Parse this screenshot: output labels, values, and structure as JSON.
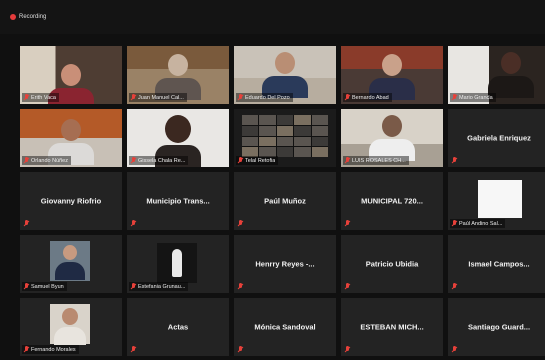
{
  "recording": {
    "label": "Recording"
  },
  "colors": {
    "muted_icon": "#e8413a",
    "tile_bg": "#232323",
    "background": "#101010"
  },
  "tiles": [
    {
      "label": "Erith Vaca"
    },
    {
      "label": "Juan Manuel Cal..."
    },
    {
      "label": "Eduardo Del Pozo"
    },
    {
      "label": "Bernardo Abad"
    },
    {
      "label": "Mario Granda"
    },
    {
      "label": "Orlando Núñez"
    },
    {
      "label": "Gissela Chala Re..."
    },
    {
      "label": "Telal Retofia"
    },
    {
      "label": "LUIS ROSALES CH..."
    },
    {
      "name": "Gabriela Enriquez"
    },
    {
      "name": "Giovanny Riofrio"
    },
    {
      "name": "Municipio Trans..."
    },
    {
      "name": "Paúl Muñoz"
    },
    {
      "name": "MUNICIPAL 720..."
    },
    {
      "label": "Paúl Andino Sal..."
    },
    {
      "label": "Samuel Byun"
    },
    {
      "label": "Estefania Grunau..."
    },
    {
      "name": "Henrry Reyes -..."
    },
    {
      "name": "Patricio Ubidia"
    },
    {
      "name": "Ismael Campos..."
    },
    {
      "label": "Fernando Morales"
    },
    {
      "name": "Actas"
    },
    {
      "name": "Mónica Sandoval"
    },
    {
      "name": "ESTEBAN MICH..."
    },
    {
      "name": "Santiago Guard..."
    }
  ]
}
